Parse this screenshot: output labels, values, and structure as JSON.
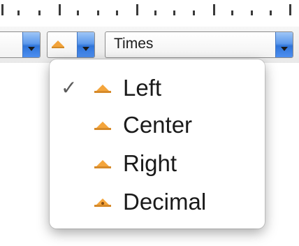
{
  "toolbar": {
    "alignment_popup_icon": "align-left-triangle-icon",
    "font_popup": {
      "value": "Times"
    }
  },
  "menu": {
    "items": [
      {
        "label": "Left",
        "icon": "align-left-icon",
        "checked": true
      },
      {
        "label": "Center",
        "icon": "align-center-icon",
        "checked": false
      },
      {
        "label": "Right",
        "icon": "align-right-icon",
        "checked": false
      },
      {
        "label": "Decimal",
        "icon": "align-decimal-icon",
        "checked": false
      }
    ],
    "check_glyph": "✓"
  },
  "colors": {
    "arrow_button_blue": "#3a7de2",
    "icon_orange": "#f4a53c"
  }
}
